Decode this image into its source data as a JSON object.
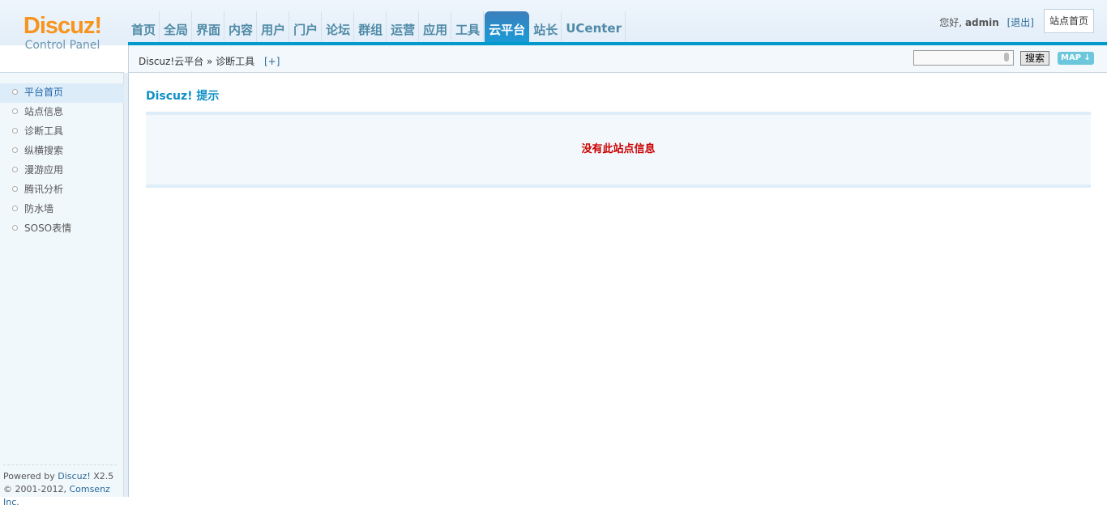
{
  "logo": {
    "brand": "Discuz!",
    "sub": "Control Panel"
  },
  "nav": [
    {
      "label": "首页"
    },
    {
      "label": "全局"
    },
    {
      "label": "界面"
    },
    {
      "label": "内容"
    },
    {
      "label": "用户"
    },
    {
      "label": "门户"
    },
    {
      "label": "论坛"
    },
    {
      "label": "群组"
    },
    {
      "label": "运营"
    },
    {
      "label": "应用"
    },
    {
      "label": "工具"
    },
    {
      "label": "云平台",
      "active": true
    },
    {
      "label": "站长"
    },
    {
      "label": "UCenter"
    }
  ],
  "user": {
    "greeting": "您好,",
    "name": "admin",
    "logout": "[退出]",
    "site_home": "站点首页"
  },
  "breadcrumb": {
    "path": "Discuz!云平台 » 诊断工具",
    "add": "[+]"
  },
  "search": {
    "value": "",
    "button": "搜索",
    "map": "MAP ↓"
  },
  "sidebar": [
    {
      "label": "平台首页",
      "active": true
    },
    {
      "label": "站点信息"
    },
    {
      "label": "诊断工具"
    },
    {
      "label": "纵横搜索"
    },
    {
      "label": "漫游应用"
    },
    {
      "label": "腾讯分析"
    },
    {
      "label": "防水墙"
    },
    {
      "label": "SOSO表情"
    }
  ],
  "footer": {
    "powered": "Powered by",
    "product": "Discuz!",
    "version": "X2.5",
    "copyright": "© 2001-2012,",
    "company": "Comsenz Inc."
  },
  "main": {
    "title": "Discuz! 提示",
    "message": "没有此站点信息"
  }
}
